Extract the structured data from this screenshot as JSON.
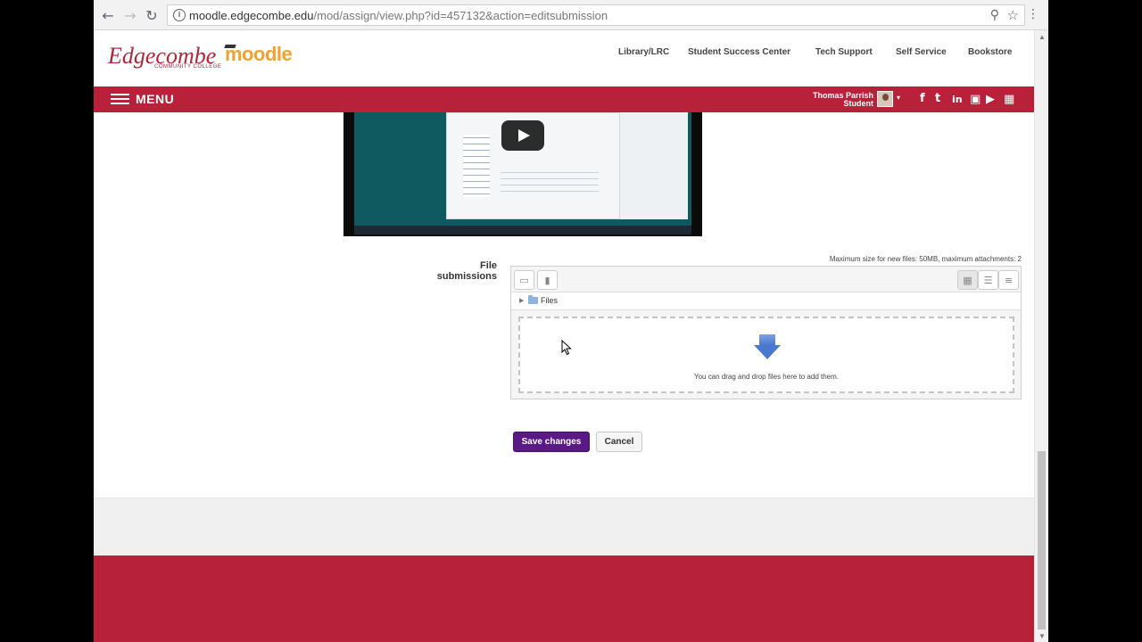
{
  "browser": {
    "url_host": "moodle.edgecombe.edu",
    "url_path": "/mod/assign/view.php?id=457132&action=editsubmission",
    "icons": {
      "back": "back-arrow-icon",
      "forward": "forward-arrow-icon",
      "reload": "reload-icon",
      "info": "info-icon",
      "zoom": "zoom-icon",
      "bookmark": "star-icon",
      "menu": "kebab-menu-icon"
    }
  },
  "header": {
    "logo_text": "Edgecombe",
    "logo_subtext": "COMMUNITY COLLEGE",
    "logo_moodle": "moodle",
    "links": [
      "Library/LRC",
      "Student Success Center",
      "Tech Support",
      "Self Service",
      "Bookstore"
    ]
  },
  "menubar": {
    "menu_label": "MENU",
    "user_name": "Thomas Parrish",
    "user_role": "Student",
    "social_icons": [
      "facebook-icon",
      "twitter-icon",
      "linkedin-icon",
      "instagram-icon",
      "youtube-icon",
      "calendar-icon"
    ]
  },
  "video": {
    "play_icon": "play-icon"
  },
  "form": {
    "file_submissions_label": "File submissions",
    "max_size_text": "Maximum size for new files: 50MB, maximum attachments: 2",
    "path_folder": "Files",
    "drop_text": "You can drag and drop files here to add them.",
    "save_label": "Save changes",
    "cancel_label": "Cancel"
  },
  "colors": {
    "brand_red": "#b8213a",
    "save_purple": "#5a1a86",
    "moodle_orange": "#f0a130"
  }
}
